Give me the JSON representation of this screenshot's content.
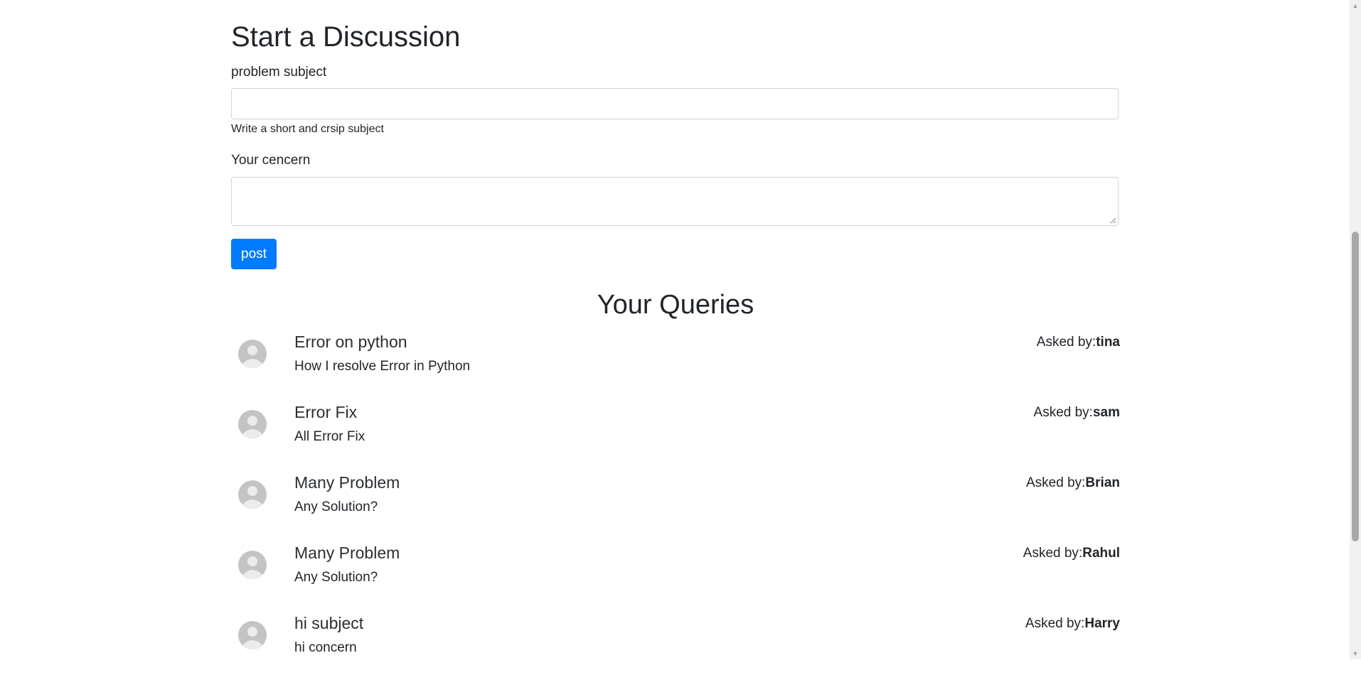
{
  "form": {
    "heading": "Start a Discussion",
    "subject_label": "problem subject",
    "subject_value": "",
    "subject_help": "Write a short and crsip subject",
    "concern_label": "Your cencern",
    "concern_value": "",
    "post_label": "post"
  },
  "queries": {
    "heading": "Your Queries",
    "asked_prefix": "Asked by:",
    "items": [
      {
        "title": "Error on python",
        "body": "How I resolve Error in Python",
        "author": "tina"
      },
      {
        "title": "Error Fix",
        "body": "All Error Fix",
        "author": "sam"
      },
      {
        "title": "Many Problem",
        "body": "Any Solution?",
        "author": "Brian"
      },
      {
        "title": "Many Problem",
        "body": "Any Solution?",
        "author": "Rahul"
      },
      {
        "title": "hi subject",
        "body": "hi concern",
        "author": "Harry"
      }
    ]
  },
  "colors": {
    "primary": "#007bff",
    "text": "#212529",
    "avatar": "#c4c4c4"
  }
}
